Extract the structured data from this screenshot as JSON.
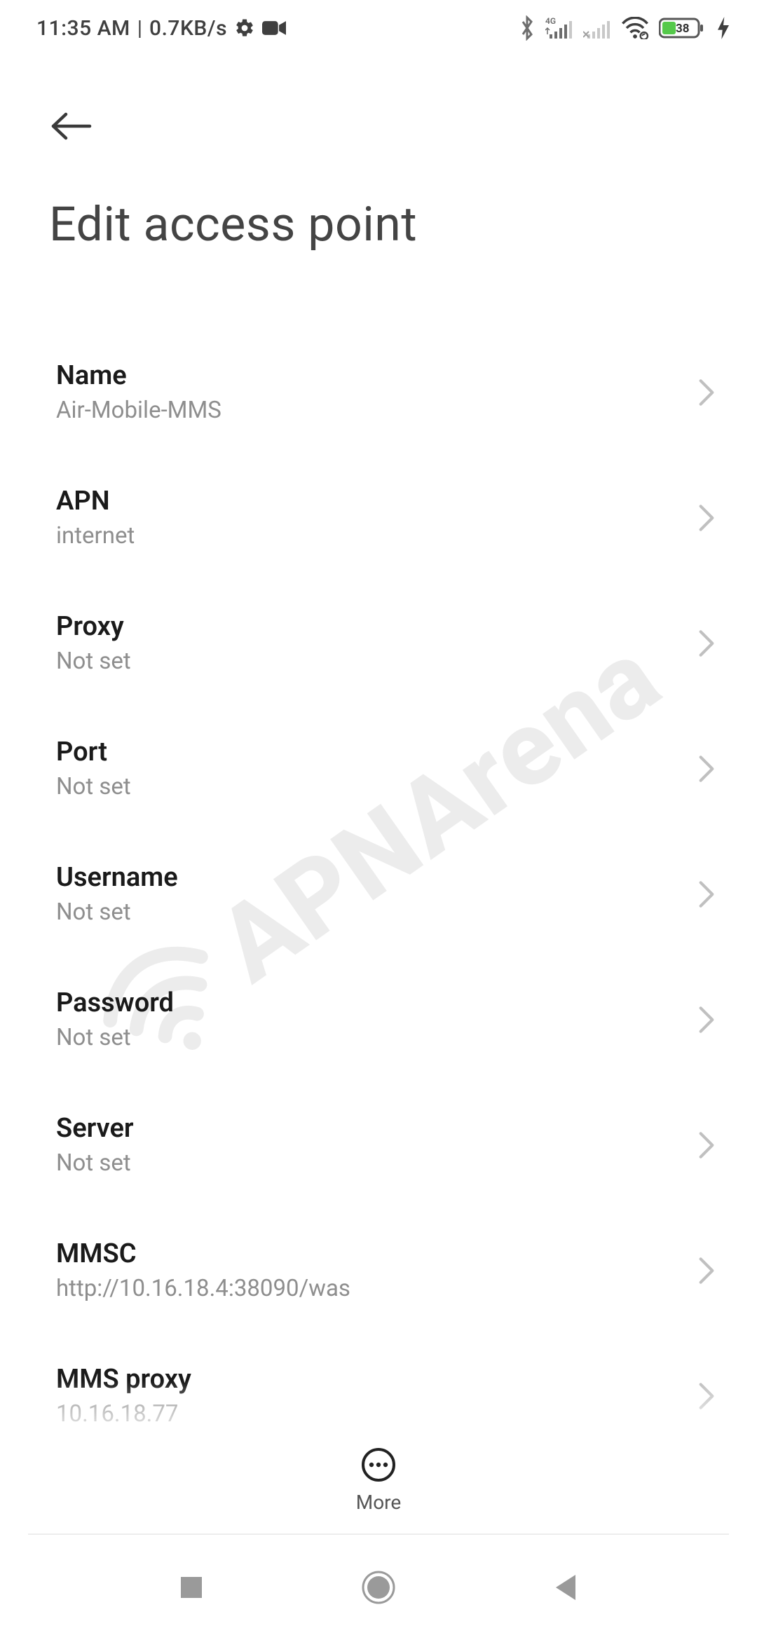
{
  "status": {
    "time": "11:35 AM",
    "speed": "0.7KB/s",
    "battery_percent": "38"
  },
  "header": {
    "title": "Edit access point"
  },
  "items": [
    {
      "label": "Name",
      "value": "Air-Mobile-MMS"
    },
    {
      "label": "APN",
      "value": "internet"
    },
    {
      "label": "Proxy",
      "value": "Not set"
    },
    {
      "label": "Port",
      "value": "Not set"
    },
    {
      "label": "Username",
      "value": "Not set"
    },
    {
      "label": "Password",
      "value": "Not set"
    },
    {
      "label": "Server",
      "value": "Not set"
    },
    {
      "label": "MMSC",
      "value": "http://10.16.18.4:38090/was"
    },
    {
      "label": "MMS proxy",
      "value": "10.16.18.77"
    }
  ],
  "bottom": {
    "more_label": "More"
  },
  "watermark": "APNArena"
}
